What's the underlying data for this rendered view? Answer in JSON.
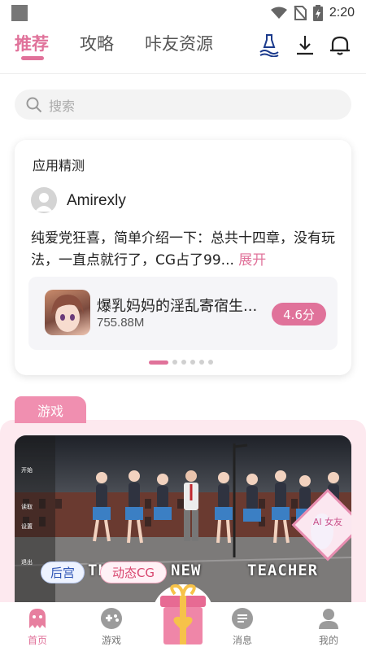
{
  "status_bar": {
    "time": "2:20"
  },
  "top_tabs": [
    {
      "label": "推荐",
      "active": true
    },
    {
      "label": "攻略",
      "active": false
    },
    {
      "label": "咔友资源",
      "active": false
    }
  ],
  "top_icons": [
    "fountain-pen-icon",
    "download-icon",
    "bell-icon"
  ],
  "search": {
    "placeholder": "搜索"
  },
  "card": {
    "title": "应用精测",
    "username": "Amirexly",
    "review": "纯爱党狂喜，简单介绍一下：总共十四章，没有玩法，一直点就行了，CG占了99...",
    "expand_label": "展开",
    "app": {
      "name": "爆乳妈妈的淫乱寄宿生...",
      "size": "755.88M",
      "rating": "4.6分"
    },
    "carousel": {
      "count": 6,
      "active": 0
    }
  },
  "section": {
    "tab_label": "游戏"
  },
  "game": {
    "tags": [
      "后宫",
      "动态CG"
    ],
    "banner_text_left": "TH",
    "banner_text_mid": "NEW",
    "banner_text_right": "TEACHER",
    "badge_text": "AI 女友"
  },
  "bottom_nav": [
    {
      "label": "首页",
      "icon": "ghost-icon",
      "active": true
    },
    {
      "label": "游戏",
      "icon": "gamepad-icon",
      "active": false
    },
    {
      "label": "",
      "icon": "gift-icon",
      "active": false
    },
    {
      "label": "消息",
      "icon": "message-icon",
      "active": false
    },
    {
      "label": "我的",
      "icon": "person-icon",
      "active": false
    }
  ],
  "colors": {
    "accent": "#e0729a",
    "section_bg": "#fde9ef",
    "section_tab": "#f08fb0"
  }
}
